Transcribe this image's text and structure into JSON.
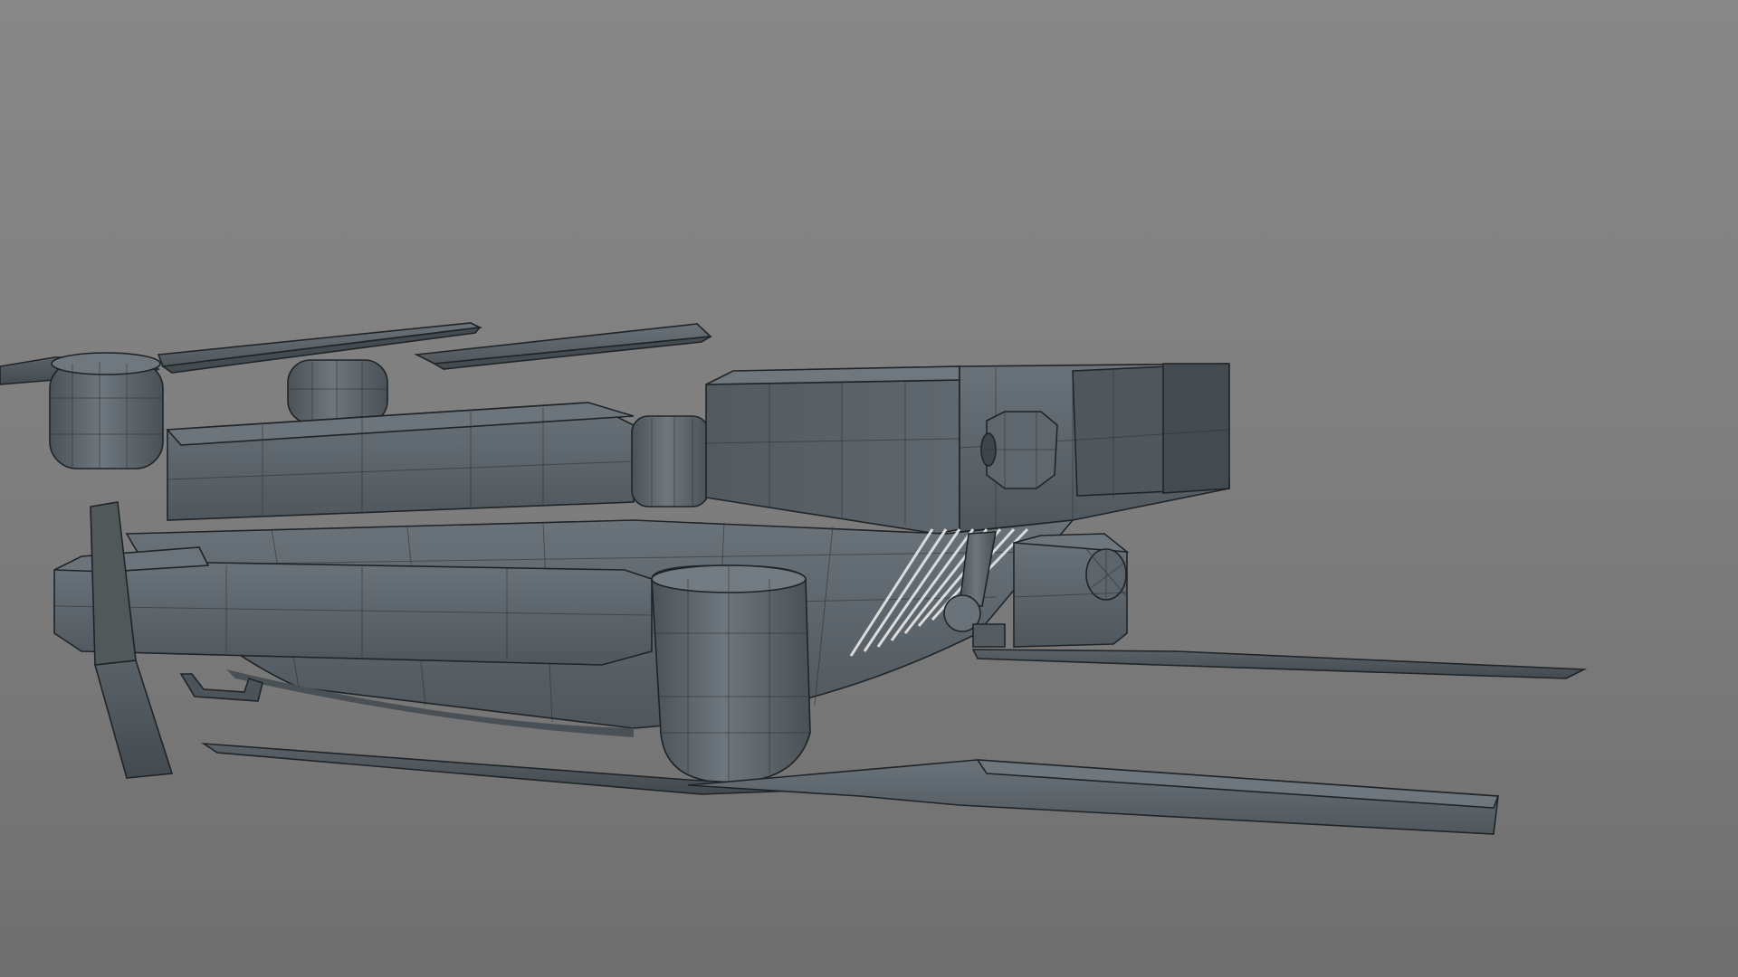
{
  "viewport": {
    "background_top": "#878787",
    "background_bottom": "#6f6f6f",
    "mesh_color": "#5b6369",
    "mesh_dark": "#4a5157",
    "mesh_light": "#6b747b",
    "wire_color": "#2a2f33"
  },
  "scene": {
    "subject": "drone-wireframe-model",
    "display_mode": "shaded-wireframe"
  }
}
